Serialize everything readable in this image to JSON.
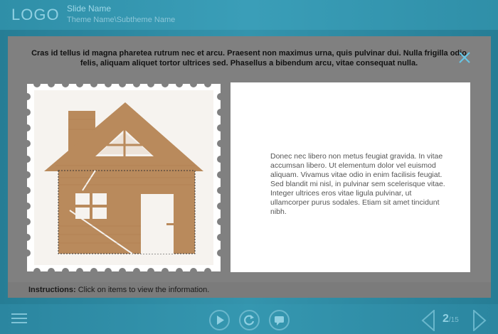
{
  "header": {
    "logo": "LOGO",
    "slide_name": "Slide Name",
    "theme_name": "Theme Name\\Subtheme Name"
  },
  "popup": {
    "header_text": "Cras id  tellus id magna pharetea rutrum nec et arcu. Praesent non maximus urna, quis pulvinar dui. Nulla frigilla odio felis, aliquam aliquet tortor ultrices sed. Phasellus a bibendum arcu, vitae consequat nulla.",
    "body_text": "Donec nec libero non metus feugiat gravida. In vitae accumsan libero. Ut elementum dolor vel euismod aliquam. Vivamus vitae odio in enim facilisis feugiat. Sed blandit mi nisl, in pulvinar sem scelerisque vitae. Integer ultrices eros vitae ligula pulvinar, ut ullamcorper purus sodales. Etiam sit amet tincidunt nibh.",
    "image_icon": "house-stamp-icon"
  },
  "instructions": {
    "label": "Instructions:",
    "text": "Click on items to view the information."
  },
  "footer": {
    "current_page": "2",
    "total_pages": "/15"
  },
  "colors": {
    "accent": "#3494ad",
    "icon": "#8fd0e2",
    "overlay": "#808080",
    "wood": "#b98a5c"
  }
}
